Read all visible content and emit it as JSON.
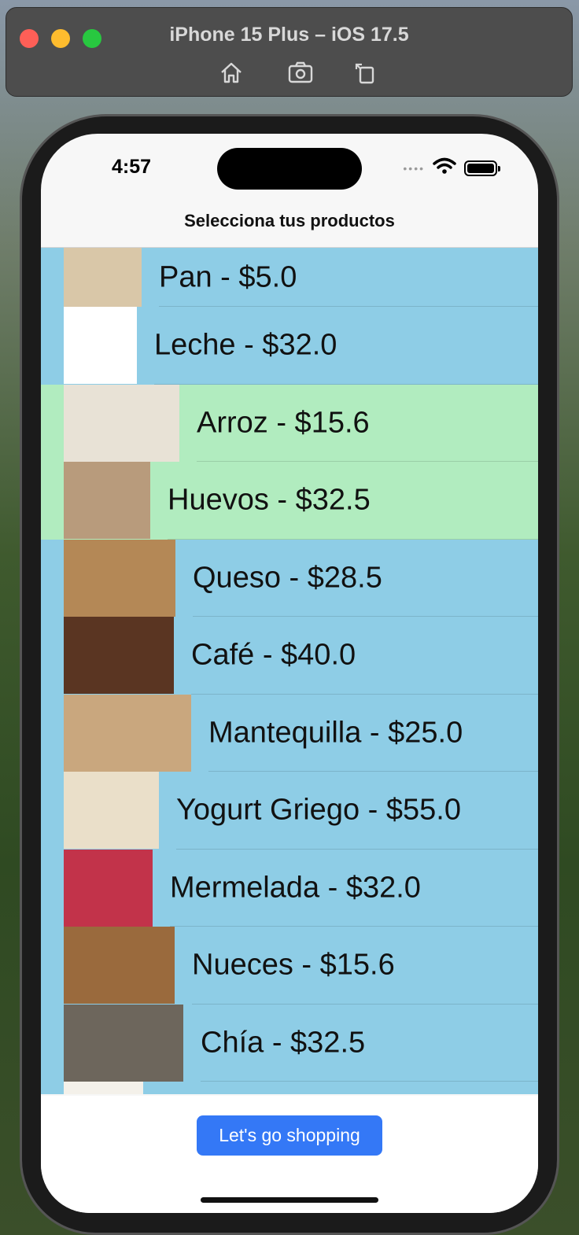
{
  "simulator": {
    "title": "iPhone 15 Plus – iOS 17.5",
    "toolbar_icons": [
      "home-icon",
      "screenshot-icon",
      "rotate-icon"
    ]
  },
  "status_bar": {
    "time": "4:57"
  },
  "nav": {
    "title": "Selecciona tus productos"
  },
  "products": [
    {
      "label": "Pan - $5.0",
      "color": "blue",
      "thumb_color": "#d9c7a8",
      "thumb_width": 99
    },
    {
      "label": "Leche - $32.0",
      "color": "blue",
      "thumb_color": "#ffffff",
      "thumb_width": 93
    },
    {
      "label": "Arroz - $15.6",
      "color": "green",
      "thumb_color": "#e8e2d6",
      "thumb_width": 147
    },
    {
      "label": "Huevos - $32.5",
      "color": "green",
      "thumb_color": "#b89b7c",
      "thumb_width": 110
    },
    {
      "label": "Queso - $28.5",
      "color": "blue",
      "thumb_color": "#b48856",
      "thumb_width": 142
    },
    {
      "label": "Café - $40.0",
      "color": "blue",
      "thumb_color": "#5a3522",
      "thumb_width": 140
    },
    {
      "label": "Mantequilla - $25.0",
      "color": "blue",
      "thumb_color": "#c9a77e",
      "thumb_width": 162
    },
    {
      "label": "Yogurt Griego - $55.0",
      "color": "blue",
      "thumb_color": "#eadfc9",
      "thumb_width": 121
    },
    {
      "label": "Mermelada - $32.0",
      "color": "blue",
      "thumb_color": "#c2334a",
      "thumb_width": 113
    },
    {
      "label": "Nueces - $15.6",
      "color": "blue",
      "thumb_color": "#9a6a3d",
      "thumb_width": 141
    },
    {
      "label": "Chía - $32.5",
      "color": "blue",
      "thumb_color": "#6d665c",
      "thumb_width": 152
    }
  ],
  "colors": {
    "row_blue": "#8ecde6",
    "row_green": "#b1ecbf",
    "button": "#3478f6"
  },
  "button": {
    "label": "Let's go shopping"
  }
}
